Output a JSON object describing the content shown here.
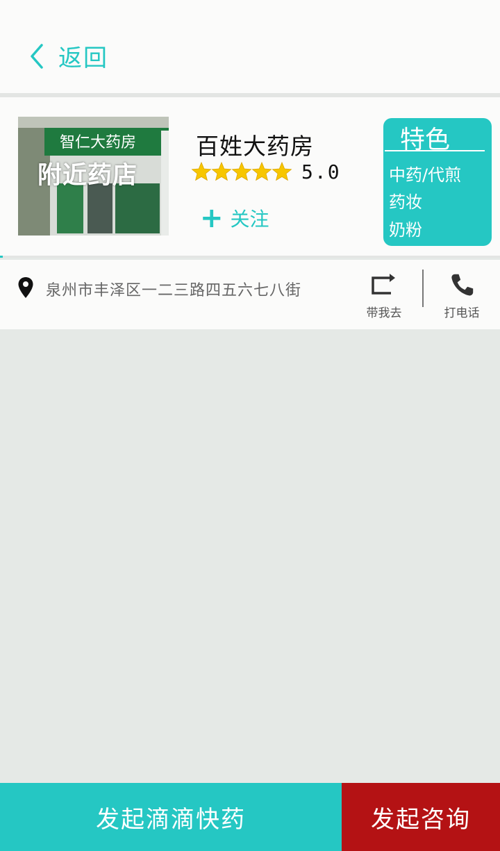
{
  "header": {
    "back_label": "返回"
  },
  "store": {
    "photo_label": "附近药店",
    "photo_sign": "智仁大药房",
    "name": "百姓大药房",
    "rating": 5,
    "rating_text": "5.0",
    "follow_label": "关注"
  },
  "features": {
    "title": "特色",
    "items": [
      "中药/代煎",
      "药妆",
      "奶粉"
    ]
  },
  "address": {
    "text": "泉州市丰泽区一二三路四五六七八街",
    "navigate_label": "带我去",
    "call_label": "打电话"
  },
  "actions": {
    "quick_medicine_label": "发起滴滴快药",
    "consult_label": "发起咨询"
  },
  "colors": {
    "accent": "#25c7c3",
    "consult": "#b41214",
    "star": "#f7c600"
  },
  "icons": {
    "back": "chevron-left-icon",
    "follow": "plus-icon",
    "location": "location-pin-icon",
    "navigate": "route-arrow-icon",
    "call": "phone-icon",
    "star": "star-icon"
  }
}
